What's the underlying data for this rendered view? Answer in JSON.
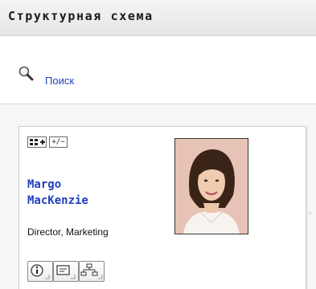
{
  "panel": {
    "title": "Структурная схема"
  },
  "search": {
    "link_label": "Поиск",
    "icon": "magnifier-icon"
  },
  "person_card": {
    "name_line1": "Margo",
    "name_line2": "MacKenzie",
    "job_title": "Director, Marketing",
    "expand_control_label": "+/−",
    "photo_icon": "person-photo",
    "actions": [
      {
        "icon": "info-icon"
      },
      {
        "icon": "message-icon"
      },
      {
        "icon": "org-chart-icon"
      }
    ]
  },
  "colors": {
    "link": "#1f3fbf",
    "header_bg": "#ececec",
    "photo_bg": "#e7c3b6"
  }
}
